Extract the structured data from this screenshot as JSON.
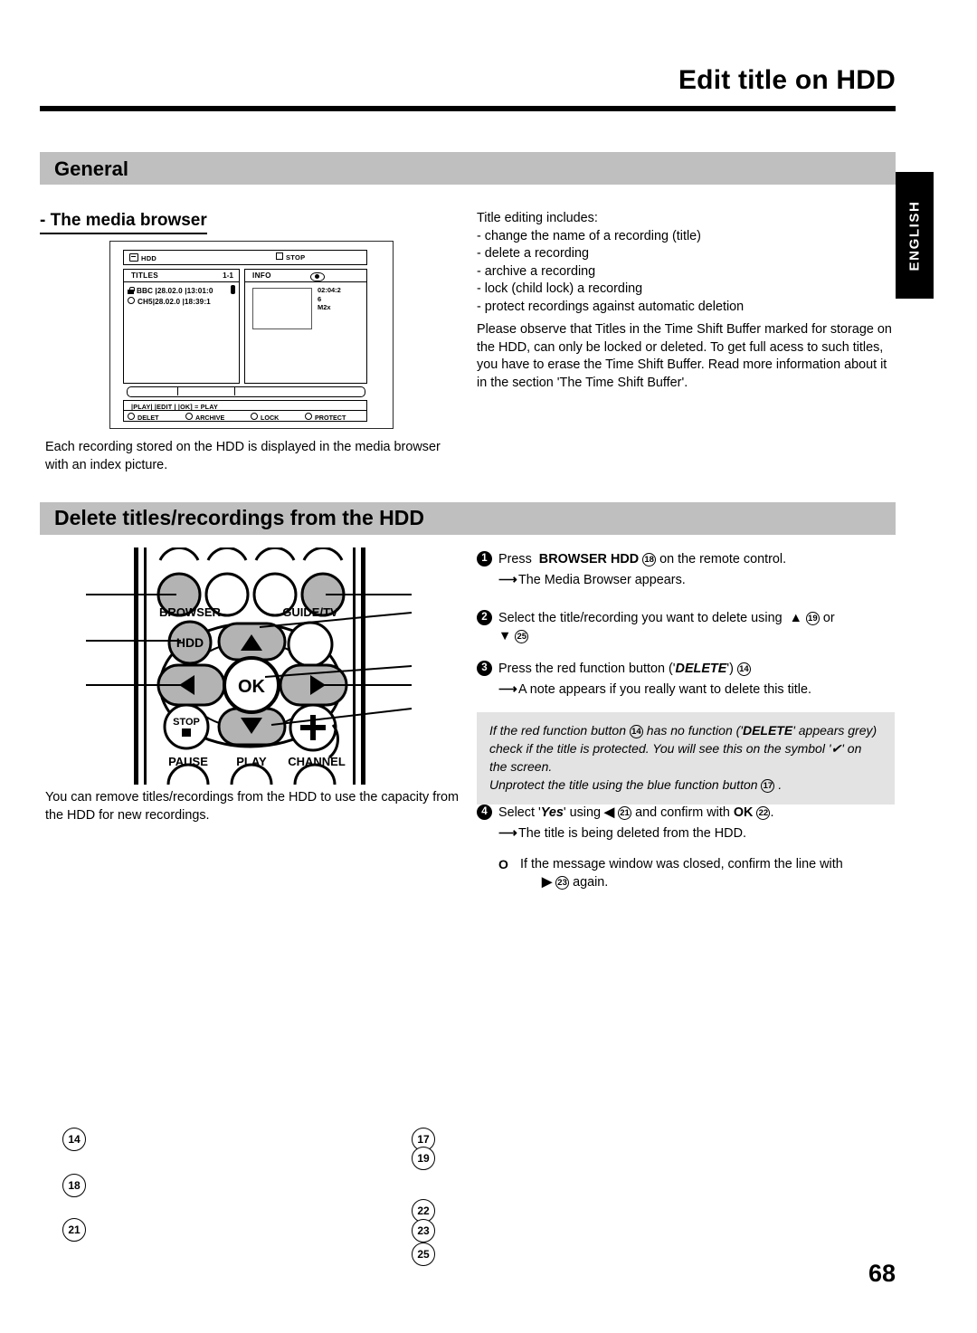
{
  "header": {
    "doc_title": "Edit title on HDD",
    "language_tab": "ENGLISH",
    "page_number": "68"
  },
  "sections": {
    "general": {
      "bar_label": "General",
      "subheading": "- The media browser",
      "intro_lead": "Title editing includes:",
      "intro_items": [
        "- change the name of a recording (title)",
        "- delete a recording",
        "- archive a recording",
        "- lock (child lock) a recording",
        "- protect recordings against automatic deletion"
      ],
      "note_paragraph": "Please observe that Titles in the Time Shift Buffer marked for storage on the HDD, can only be locked or deleted. To get full acess to such titles, you have to erase the Time Shift Buffer. Read more information about it in the section 'The Time Shift Buffer'.",
      "caption": "Each recording stored on the HDD is displayed in the media browser with an index picture."
    },
    "delete": {
      "bar_label": "Delete titles/recordings from the HDD",
      "caption": "You can remove titles/recordings from the HDD to use the capacity from the HDD for new recordings."
    }
  },
  "media_browser": {
    "status_bar": {
      "source": "HDD",
      "state": "STOP"
    },
    "titles_panel": {
      "header": "TITLES",
      "counter": "1-1"
    },
    "titles": [
      {
        "channel": "BBC",
        "date": "28.02.0",
        "time": "13:01:0",
        "locked": true,
        "selected": true
      },
      {
        "channel": "CH5",
        "date": "28.02.0",
        "time": "18:39:1",
        "locked": false,
        "selected": false
      }
    ],
    "info_panel": {
      "header": "INFO",
      "values": [
        "02:04:2",
        "6",
        "M2x"
      ]
    },
    "legend_line": "|PLAY| |EDIT | |OK]  = PLAY",
    "function_buttons": [
      "DELET",
      "ARCHIVE",
      "LOCK",
      "PROTECT"
    ]
  },
  "remote": {
    "labels": {
      "browser": "BROWSER",
      "hdd": "HDD",
      "guide_tv": "GUIDE/TV",
      "ok": "OK",
      "stop": "STOP",
      "pause": "PAUSE",
      "play": "PLAY",
      "channel": "CHANNEL"
    },
    "callouts_left": [
      "14",
      "18",
      "21"
    ],
    "callouts_right": [
      "17",
      "19",
      "22",
      "23",
      "25"
    ]
  },
  "steps": [
    {
      "num": "1",
      "pre": "Press",
      "key": "BROWSER HDD",
      "ref": "18",
      "post": "on the remote control.",
      "result": "The Media Browser appears."
    },
    {
      "num": "2",
      "pre": "Select the title/recording you want to delete using",
      "key_up": "▲",
      "ref_up": "19",
      "or": "or",
      "key_down": "▼",
      "ref_down": "25"
    },
    {
      "num": "3",
      "pre": "Press the red function button ('",
      "key": "DELETE",
      "mid": "')",
      "ref": "14",
      "result": "A note appears if you really want to delete this title."
    },
    {
      "num": "4",
      "pre": "Select '",
      "key": "Yes",
      "mid": "' using",
      "arrow_left": "◀",
      "ref_left": "21",
      "mid2": "and confirm with",
      "ok": "OK",
      "ref_ok": "22",
      "period": ".",
      "result": "The title is being deleted from the HDD."
    }
  ],
  "note_box": {
    "line1_a": "If the red function button",
    "line1_ref": "14",
    "line1_b": "has no function ('",
    "line1_key": "DELETE",
    "line1_c": "' appears grey) check if the title is protected. You will see this on the symbol '✔'  on the screen.",
    "line2_a": "Unprotect the title using the blue function button",
    "line2_ref": "17",
    "line2_b": "."
  },
  "final_note": {
    "marker": "O",
    "text": "If the message window was closed, confirm the line with",
    "arrow": "▶",
    "ref": "23",
    "tail": "again."
  }
}
